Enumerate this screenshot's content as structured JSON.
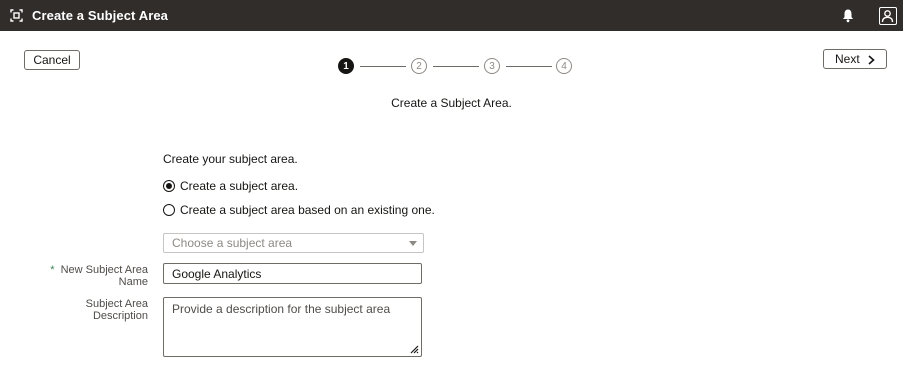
{
  "window": {
    "title": "Create a Subject Area"
  },
  "toolbar": {
    "cancel_label": "Cancel",
    "next_label": "Next"
  },
  "train": {
    "steps": [
      {
        "label": "1",
        "state": "active"
      },
      {
        "label": "2",
        "state": "inactive"
      },
      {
        "label": "3",
        "state": "inactive"
      },
      {
        "label": "4",
        "state": "inactive"
      }
    ]
  },
  "page": {
    "subtitle": "Create a Subject Area."
  },
  "form": {
    "heading": "Create your subject area.",
    "options": [
      {
        "label": "Create a subject area.",
        "selected": true
      },
      {
        "label": "Create a subject area based on an existing one.",
        "selected": false
      }
    ],
    "existing_select": {
      "placeholder": "Choose a subject area"
    },
    "name": {
      "required_marker": "*",
      "label_line1": "New Subject Area",
      "label_line2": "Name",
      "value": "Google Analytics"
    },
    "description": {
      "label_line1": "Subject Area",
      "label_line2": "Description",
      "placeholder": "Provide a description for the subject area"
    }
  },
  "icons": {
    "app": "subject-area-icon",
    "notifications": "bell-icon",
    "profile": "user-profile-icon",
    "next": "chevron-right-icon",
    "select": "caret-down-icon",
    "resize": "resize-handle-icon"
  }
}
